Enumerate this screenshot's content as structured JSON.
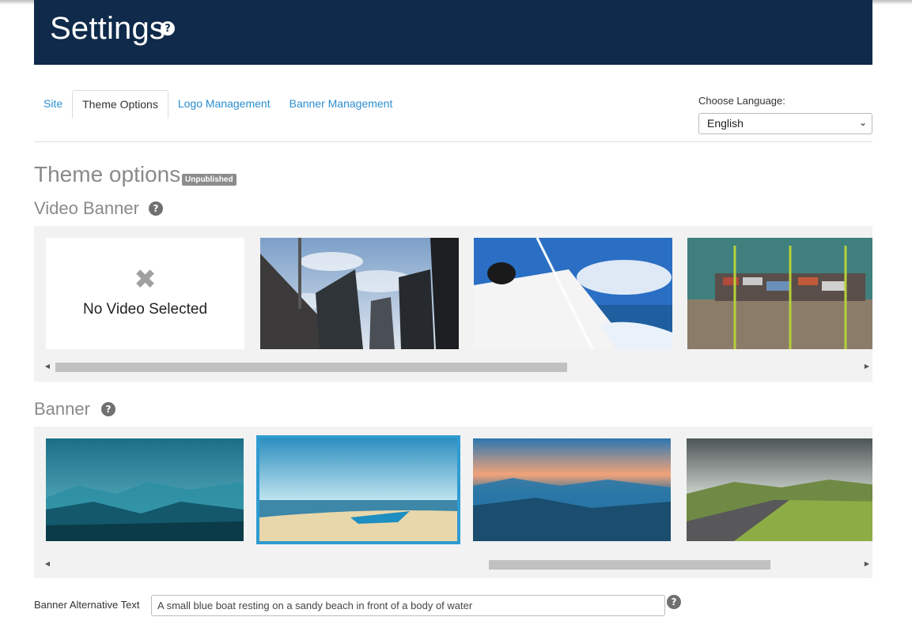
{
  "header": {
    "title": "Settings",
    "help_icon": "question-circle-icon",
    "bg_color": "#0f2a4a"
  },
  "tabs": [
    {
      "label": "Site",
      "active": false
    },
    {
      "label": "Theme Options",
      "active": true
    },
    {
      "label": "Logo Management",
      "active": false
    },
    {
      "label": "Banner Management",
      "active": false
    }
  ],
  "language": {
    "label": "Choose Language:",
    "selected": "English"
  },
  "theme": {
    "title": "Theme options",
    "status_badge": "Unpublished"
  },
  "video_banner": {
    "title": "Video Banner",
    "no_video_text": "No Video Selected",
    "thumbnails": [
      "city-skyline",
      "sailboat",
      "cargo-ship-port"
    ]
  },
  "banner": {
    "title": "Banner",
    "thumbnails": [
      "misty-mountains",
      "boat-on-beach",
      "sunset-mountains",
      "countryside-road"
    ],
    "selected": "boat-on-beach",
    "selected_color": "#2f9bd2"
  },
  "alt_text": {
    "label": "Banner Alternative Text",
    "value": "A small blue boat resting on a sandy beach in front of a body of water"
  },
  "colors": {
    "link": "#2b8ed1",
    "badge": "#8c8c8c"
  }
}
